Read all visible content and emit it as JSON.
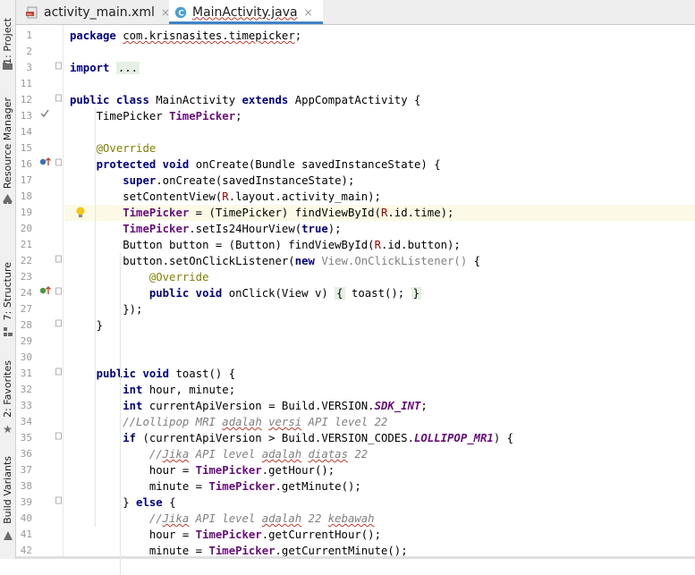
{
  "tool_windows": [
    {
      "id": "project",
      "label": "1: Project",
      "icon": "folder-icon"
    },
    {
      "id": "resource",
      "label": "Resource Manager",
      "icon": "resource-icon"
    },
    {
      "id": "structure",
      "label": "7: Structure",
      "icon": "structure-icon"
    },
    {
      "id": "favorites",
      "label": "2: Favorites",
      "icon": "star-icon"
    },
    {
      "id": "build",
      "label": "Build Variants",
      "icon": "build-icon"
    }
  ],
  "tabs": [
    {
      "label": "activity_main.xml",
      "icon": "xml-file-icon",
      "active": false,
      "close": "×"
    },
    {
      "label": "MainActivity.java",
      "icon": "java-class-icon",
      "active": true,
      "close": "×"
    }
  ],
  "editor": {
    "current_line": "19",
    "lines": [
      {
        "num": "1",
        "text": "package com.krisnasites.timepicker;"
      },
      {
        "num": "2",
        "text": ""
      },
      {
        "num": "3",
        "text": "import ..."
      },
      {
        "num": "11",
        "text": ""
      },
      {
        "num": "12",
        "text": "public class MainActivity extends AppCompatActivity {"
      },
      {
        "num": "13",
        "text": "    TimePicker TimePicker;"
      },
      {
        "num": "14",
        "text": ""
      },
      {
        "num": "15",
        "text": "    @Override"
      },
      {
        "num": "16",
        "text": "    protected void onCreate(Bundle savedInstanceState) {"
      },
      {
        "num": "17",
        "text": "        super.onCreate(savedInstanceState);"
      },
      {
        "num": "18",
        "text": "        setContentView(R.layout.activity_main);"
      },
      {
        "num": "19",
        "text": "        TimePicker = (TimePicker) findViewById(R.id.time);"
      },
      {
        "num": "20",
        "text": "        TimePicker.setIs24HourView(true);"
      },
      {
        "num": "21",
        "text": "        Button button = (Button) findViewById(R.id.button);"
      },
      {
        "num": "22",
        "text": "        button.setOnClickListener(new View.OnClickListener() {"
      },
      {
        "num": "23",
        "text": "            @Override"
      },
      {
        "num": "24",
        "text": "            public void onClick(View v) { toast(); }"
      },
      {
        "num": "27",
        "text": "        });"
      },
      {
        "num": "28",
        "text": "    }"
      },
      {
        "num": "29",
        "text": ""
      },
      {
        "num": "30",
        "text": ""
      },
      {
        "num": "31",
        "text": "    public void toast() {"
      },
      {
        "num": "32",
        "text": "        int hour, minute;"
      },
      {
        "num": "33",
        "text": "        int currentApiVersion = Build.VERSION.SDK_INT;"
      },
      {
        "num": "34",
        "text": "        //Lollipop MRI adalah versi API level 22"
      },
      {
        "num": "35",
        "text": "        if (currentApiVersion > Build.VERSION_CODES.LOLLIPOP_MR1) {"
      },
      {
        "num": "36",
        "text": "            //Jika API level adalah diatas 22"
      },
      {
        "num": "37",
        "text": "            hour = TimePicker.getHour();"
      },
      {
        "num": "38",
        "text": "            minute = TimePicker.getMinute();"
      },
      {
        "num": "39",
        "text": "        } else {"
      },
      {
        "num": "40",
        "text": "            //Jika API level adalah 22 kebawah"
      },
      {
        "num": "41",
        "text": "            hour = TimePicker.getCurrentHour();"
      },
      {
        "num": "42",
        "text": "            minute = TimePicker.getCurrentMinute();"
      }
    ]
  },
  "colors": {
    "keyword": "#000080",
    "field": "#660e7a",
    "annotation": "#808000",
    "comment": "#808080",
    "r_ref": "#9b0000",
    "active_tab_underline": "#4083c9",
    "current_line_bg": "#fcfae6"
  }
}
